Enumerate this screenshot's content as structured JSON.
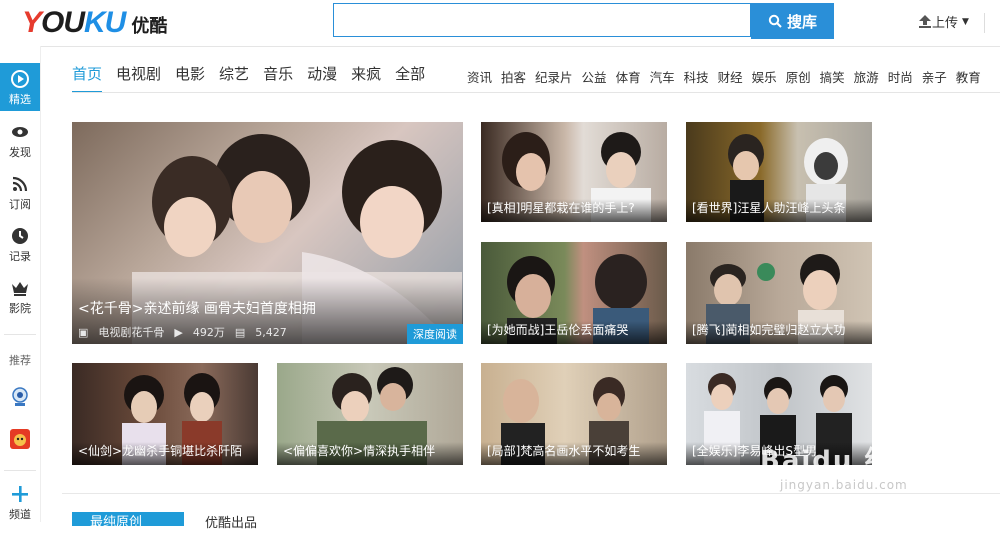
{
  "header": {
    "logo_en": "YOUKU",
    "logo_cn": "优酷",
    "search_placeholder": "",
    "search_button": "搜库",
    "upload": "上传"
  },
  "sidebar": {
    "items": [
      {
        "label": "精选",
        "icon": "play-circle-icon",
        "active": true
      },
      {
        "label": "发现",
        "icon": "eye-icon"
      },
      {
        "label": "订阅",
        "icon": "rss-icon"
      },
      {
        "label": "记录",
        "icon": "clock-icon"
      },
      {
        "label": "影院",
        "icon": "crown-icon"
      }
    ],
    "recommend_label": "推荐",
    "add_label": "频道"
  },
  "nav": {
    "main": [
      "首页",
      "电视剧",
      "电影",
      "综艺",
      "音乐",
      "动漫",
      "来疯",
      "全部"
    ],
    "sub": [
      "资讯",
      "拍客",
      "纪录片",
      "公益",
      "体育",
      "汽车",
      "科技",
      "财经",
      "娱乐",
      "原创",
      "搞笑",
      "旅游",
      "时尚",
      "亲子",
      "教育"
    ]
  },
  "featured": {
    "caption": "<花千骨>亲述前缘 画骨夫妇首度相拥",
    "channel": "电视剧花千骨",
    "plays": "492万",
    "comments": "5,427",
    "badge": "深度阅读"
  },
  "tiles": [
    {
      "caption": "[真相]明星都栽在谁的手上?"
    },
    {
      "caption": "[看世界]汪星人助汪峰上头条"
    },
    {
      "caption": "[为她而战]王岳伦丢面痛哭"
    },
    {
      "caption": "[腾飞]蔺相如完璧归赵立大功"
    },
    {
      "caption": "<仙剑>龙幽杀手铜堪比杀阡陌"
    },
    {
      "caption": "<偏偏喜欢你>情深执手相伴"
    },
    {
      "caption": "[局部]梵高名画水平不如考生"
    },
    {
      "caption": "[全娱乐]李易峰出S型男"
    }
  ],
  "section": {
    "tab_active": "最纯原创",
    "tab_other": "优酷出品"
  },
  "watermark": {
    "main": "Baidu 经验",
    "sub": "jingyan.baidu.com"
  }
}
